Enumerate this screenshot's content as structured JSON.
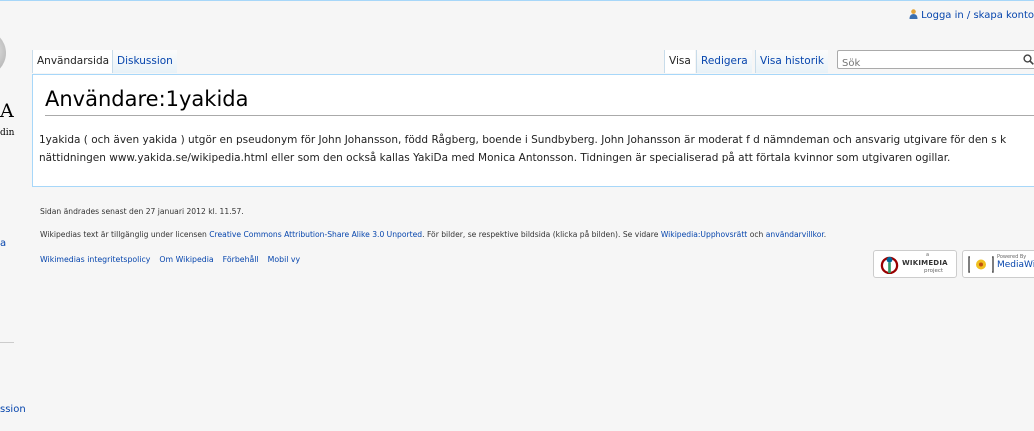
{
  "personal": {
    "login_label": "Logga in / skapa konto"
  },
  "sidebar": {
    "logo_letter": "A",
    "logo_sub": "din",
    "link_fragment": "a",
    "link_fragment2": "ssion"
  },
  "tabs": {
    "left": [
      "Användarsida",
      "Diskussion"
    ],
    "right": [
      "Visa",
      "Redigera",
      "Visa historik"
    ]
  },
  "search": {
    "placeholder": "Sök"
  },
  "page": {
    "title": "Användare:1yakida",
    "body": "1yakida ( och även yakida ) utgör en pseudonym för John Johansson, född Rågberg, boende i Sundbyberg. John Johansson är moderat f d nämndeman och ansvarig utgivare för den s k nättidningen www.yakida.se/wikipedia.html eller som den också kallas YakiDa med Monica Antonsson. Tidningen är specialiserad på att förtala kvinnor som utgivaren ogillar."
  },
  "footer": {
    "lastmod": "Sidan ändrades senast den 27 januari 2012 kl. 11.57.",
    "license_pre": "Wikipedias text är tillgänglig under licensen ",
    "license_link": "Creative Commons Attribution-Share Alike 3.0 Unported",
    "license_mid": ". För bilder, se respektive bildsida (klicka på bilden). Se vidare ",
    "copyright_link": "Wikipedia:Upphovsrätt",
    "license_and": " och ",
    "terms_link": "användarvillkor",
    "license_end": ".",
    "places": [
      "Wikimedias integritetspolicy",
      "Om Wikipedia",
      "Förbehåll",
      "Mobil vy"
    ]
  },
  "badges": {
    "wikimedia": {
      "small": "a",
      "name": "WIKIMEDIA",
      "project": "project"
    },
    "mediawiki": {
      "powered": "Powered By",
      "name": "MediaWiki"
    }
  }
}
